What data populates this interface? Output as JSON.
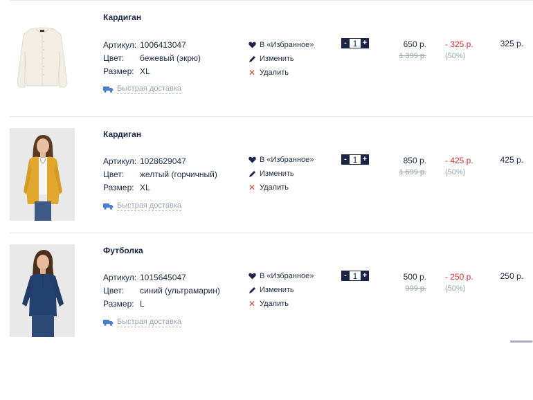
{
  "cart": {
    "attr_labels": {
      "article": "Артикул:",
      "color": "Цвет:",
      "size": "Размер:"
    },
    "actions": {
      "favorite": "В «Избранное»",
      "edit": "Изменить",
      "delete": "Удалить"
    },
    "delivery_label": "Быстрая доставка",
    "items": [
      {
        "name": "Кардиган",
        "article": "1006413047",
        "color": "бежевый (экрю)",
        "size": "XL",
        "quantity": "1",
        "price": "650 р.",
        "old_price": "1 399 р.",
        "discount": "- 325 р.",
        "discount_pct": "(50%)",
        "total": "325 р.",
        "image": "cream-cardigan"
      },
      {
        "name": "Кардиган",
        "article": "1028629047",
        "color": "желтый (горчичный)",
        "size": "XL",
        "quantity": "1",
        "price": "850 р.",
        "old_price": "1 699 р.",
        "discount": "- 425 р.",
        "discount_pct": "(50%)",
        "total": "425 р.",
        "image": "mustard-cardigan-model"
      },
      {
        "name": "Футболка",
        "article": "1015645047",
        "color": "синий (ультрамарин)",
        "size": "L",
        "quantity": "1",
        "price": "500 р.",
        "old_price": "999 р.",
        "discount": "- 250 р.",
        "discount_pct": "(50%)",
        "total": "250 р.",
        "image": "navy-top-model"
      }
    ]
  },
  "colors": {
    "brand_navy": "#1b2447",
    "discount_red": "#d22f2f",
    "muted_gray": "#9aa0ae",
    "delete_red": "#d9423c"
  },
  "icons": {
    "favorite": "heart-icon",
    "edit": "pencil-icon",
    "delete": "close-icon",
    "delivery": "truck-icon",
    "qty_minus": "minus-icon",
    "qty_plus": "plus-icon"
  },
  "qty_symbols": {
    "minus": "-",
    "plus": "+"
  }
}
